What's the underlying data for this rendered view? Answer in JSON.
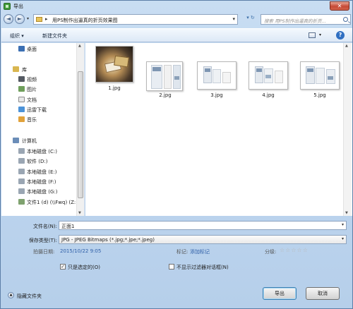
{
  "window": {
    "title": "导出",
    "close_glyph": "✕"
  },
  "address": {
    "back_glyph": "◄",
    "forward_glyph": "►",
    "arrow": "▸",
    "path": "用PS制作出逼真的折页效果图",
    "refresh_glyph": "▾ ↻",
    "dd_glyph": "▾"
  },
  "search": {
    "placeholder": "搜索 用PS制作出逼真的折页..."
  },
  "toolbar": {
    "organize": "组织 ▾",
    "new_folder": "新建文件夹",
    "view_dd": "▾",
    "help": "?"
  },
  "navpane": {
    "desktop": "桌面",
    "libraries": "库",
    "videos": "视频",
    "pictures": "图片",
    "documents": "文档",
    "thunder": "迅雷下载",
    "music": "音乐",
    "computer": "计算机",
    "drive_c": "本地磁盘 (C:)",
    "drive_d": "软件 (D:)",
    "drive_e": "本地磁盘 (E:)",
    "drive_f": "本地磁盘 (F:)",
    "drive_g": "本地磁盘 (G:)",
    "network": "文件1 (d) (\\\\Fwq) (Z:"
  },
  "files": [
    {
      "name": "1.jpg"
    },
    {
      "name": "2.jpg"
    },
    {
      "name": "3.jpg"
    },
    {
      "name": "4.jpg"
    },
    {
      "name": "5.jpg"
    }
  ],
  "form": {
    "filename_label": "文件名(N):",
    "filename_value": "正面1",
    "filetype_label": "保存类型(T):",
    "filetype_value": "JPG - JPEG Bitmaps (*.jpg;*.jpe;*.jpeg)",
    "date_label": "拍摄日期:",
    "date_value": "2015/10/22 9:05",
    "tags_label": "标记:",
    "tags_value": "添加标记",
    "rating_label": "分级:",
    "rating_stars": [
      "☆",
      "☆",
      "☆",
      "☆",
      "☆"
    ],
    "only_selected_label": "只是选定的(O)",
    "no_filter_dialog_label": "不显示过滤器对话框(N)",
    "check_mark": "✓"
  },
  "footer": {
    "hide_folders": "隐藏文件夹",
    "collapse_glyph": "▲",
    "export_button": "导出",
    "cancel_button": "取消"
  }
}
